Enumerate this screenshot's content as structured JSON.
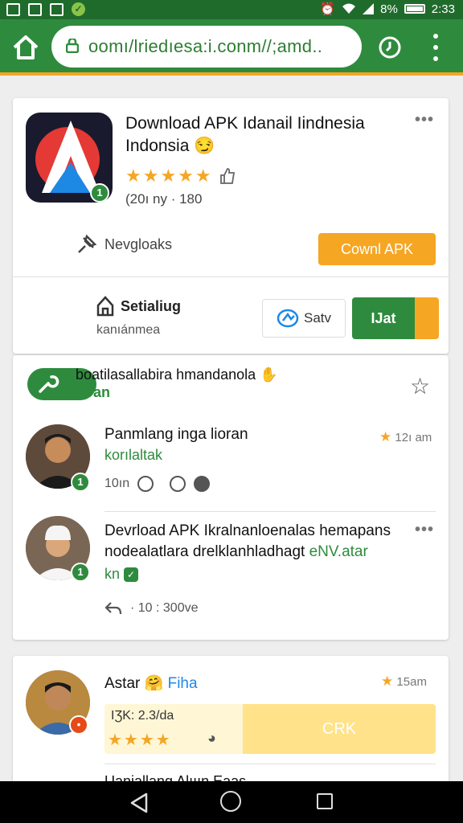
{
  "status_bar": {
    "time": "2:33",
    "signal_label": "8%"
  },
  "browser": {
    "url": "oomı/lriedıesa:i.conm//;amd..",
    "icons": [
      "home-icon",
      "lock-icon",
      "clock-icon",
      "more-vert-icon"
    ]
  },
  "app_card": {
    "title": "Download APK Idanail Iindnesia Indonsia",
    "emoji": "😏",
    "rating_stars": "★★★★★",
    "meta": "(20ı ny · 180",
    "downloads_label": "Nevgloaks",
    "download_button": "Cownl APK",
    "setting_title": "Setialiug",
    "setting_sub": "kanıánmea",
    "save_button": "Satv",
    "green_button": "IJat"
  },
  "post_card": {
    "header_title": "boatilasallabira hmandanola",
    "header_sub": "boan",
    "posts": [
      {
        "name": "Panmlang inga lioran",
        "subtitle": "korılaltak",
        "time": "12ı am",
        "meta": "10ın",
        "badge": "1"
      },
      {
        "name": "Devrload APK Ikralnanloenalas hemapans",
        "subtitle_black": "nodealatlara drelklanhladhagt",
        "subtitle_green": "eNV.atar",
        "line3": "kn",
        "reply_meta": "· 10 : 300ve",
        "badge": "1"
      }
    ]
  },
  "bottom_card": {
    "name": "Astar",
    "name_emoji": "🤗",
    "name_suffix": "Fiha",
    "time": "15am",
    "stats_text": "IƷK:     2.3/da",
    "stats_stars": "★★★★",
    "stats_button": "CRK",
    "peek_text": "Uaniallang Alııın Eaas"
  },
  "colors": {
    "brand_green": "#2e8b3d",
    "accent_orange": "#f5a623"
  }
}
